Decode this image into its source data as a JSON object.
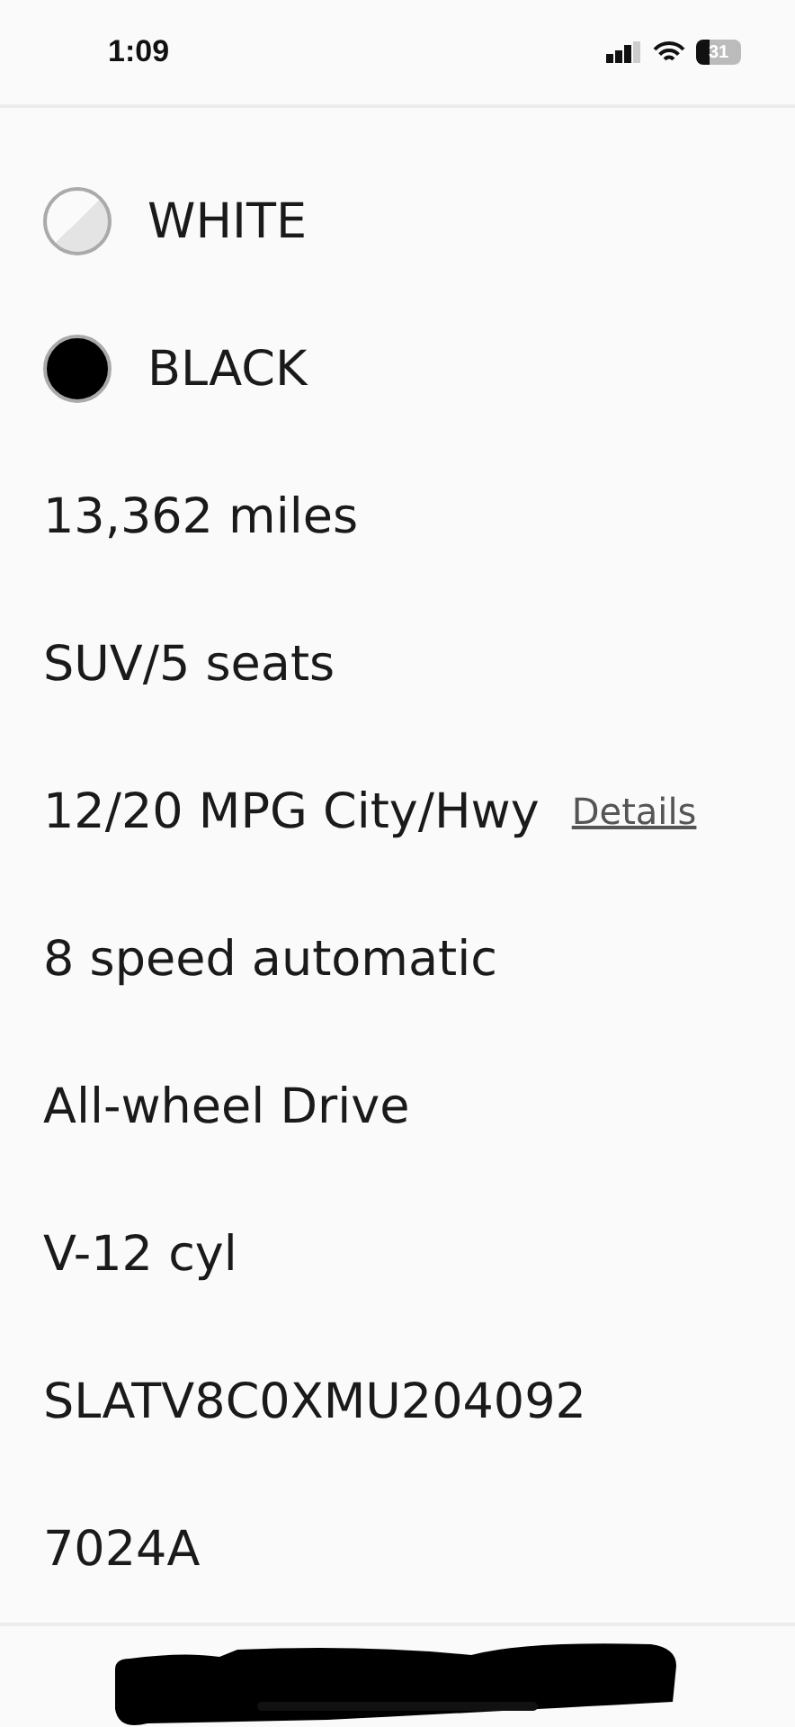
{
  "status_bar": {
    "time": "1:09",
    "battery": "31"
  },
  "colors": [
    {
      "name": "WHITE",
      "color": "#e4e4e4"
    },
    {
      "name": "BLACK",
      "color": "#000000"
    }
  ],
  "specs": [
    {
      "text": "13,362 miles"
    },
    {
      "text": "SUV/5 seats"
    },
    {
      "text": "12/20 MPG City/Hwy",
      "link": "Details"
    },
    {
      "text": "8 speed automatic"
    },
    {
      "text": "All-wheel Drive"
    },
    {
      "text": "V-12 cyl"
    },
    {
      "text": "SLATV8C0XMU204092"
    },
    {
      "text": "7024A"
    }
  ]
}
